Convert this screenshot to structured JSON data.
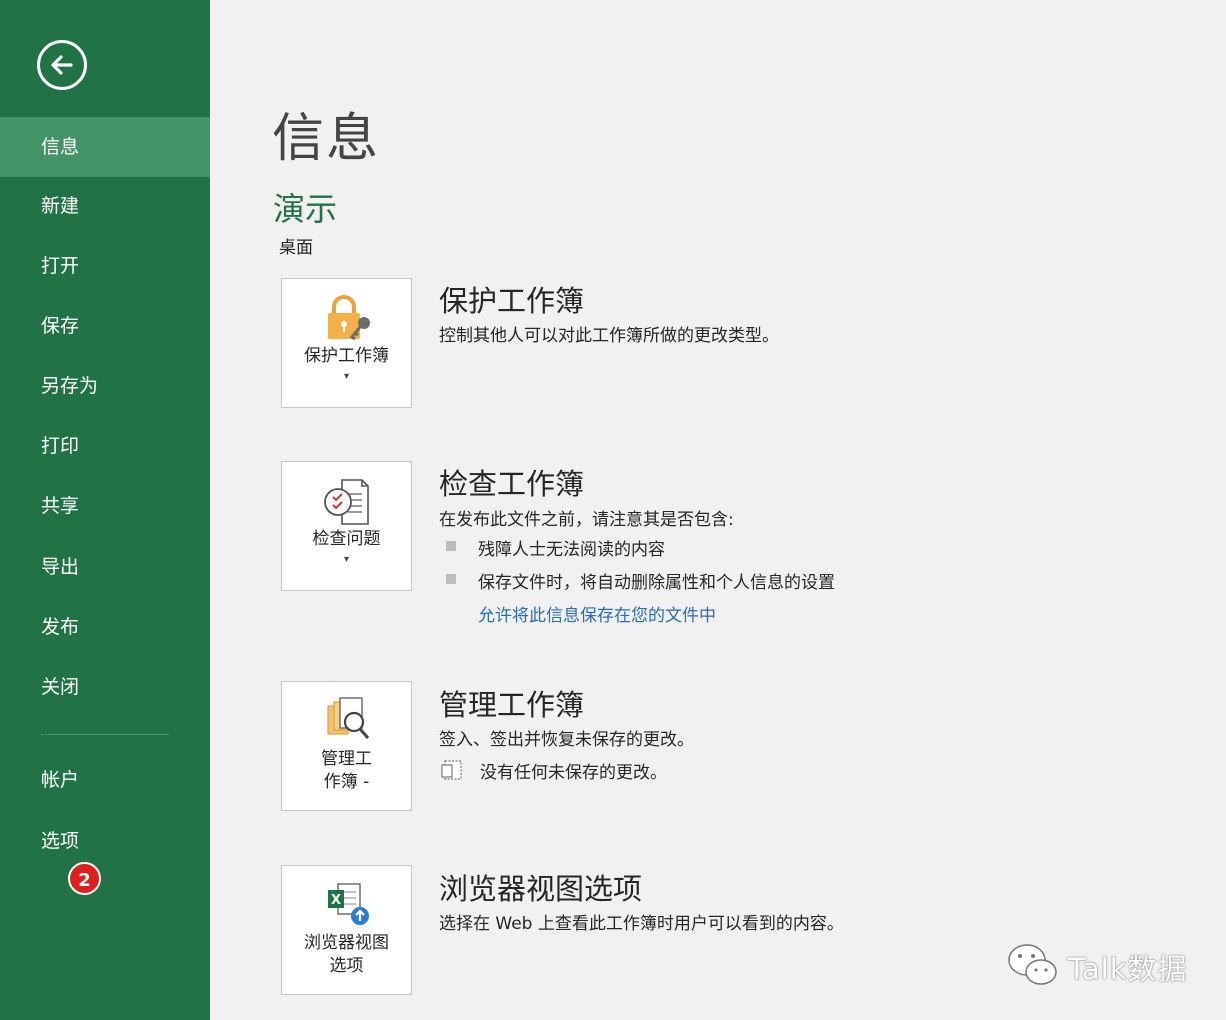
{
  "sidebar": {
    "items": [
      {
        "label": "信息"
      },
      {
        "label": "新建"
      },
      {
        "label": "打开"
      },
      {
        "label": "保存"
      },
      {
        "label": "另存为"
      },
      {
        "label": "打印"
      },
      {
        "label": "共享"
      },
      {
        "label": "导出"
      },
      {
        "label": "发布"
      },
      {
        "label": "关闭"
      },
      {
        "label": "帐户"
      },
      {
        "label": "选项"
      }
    ],
    "badge": "2"
  },
  "main": {
    "title": "信息",
    "file_name": "演示",
    "file_path": "桌面",
    "sections": {
      "protect": {
        "tile_label": "保护工作簿",
        "title": "保护工作簿",
        "desc": "控制其他人可以对此工作簿所做的更改类型。"
      },
      "inspect": {
        "tile_label": "检查问题",
        "title": "检查工作簿",
        "desc": "在发布此文件之前，请注意其是否包含:",
        "bullets": [
          "残障人士无法阅读的内容",
          "保存文件时，将自动删除属性和个人信息的设置"
        ],
        "link": "允许将此信息保存在您的文件中"
      },
      "manage": {
        "tile_label_line1": "管理工",
        "tile_label_line2": "作簿 -",
        "title": "管理工作簿",
        "desc": "签入、签出并恢复未保存的更改。",
        "status": "没有任何未保存的更改。"
      },
      "browser": {
        "tile_label_line1": "浏览器视图",
        "tile_label_line2": "选项",
        "title": "浏览器视图选项",
        "desc": "选择在 Web 上查看此工作簿时用户可以看到的内容。"
      }
    }
  },
  "watermark": {
    "text": "Talk数据"
  },
  "colors": {
    "sidebar": "#217346",
    "sidebar_active": "#439467",
    "link": "#2b6cb3",
    "accent_green": "#217346"
  }
}
